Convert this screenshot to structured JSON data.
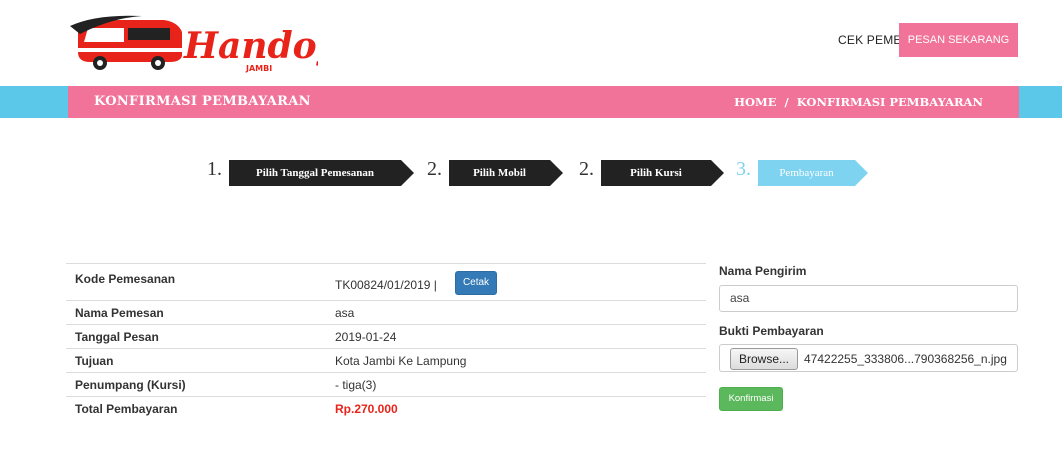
{
  "header": {
    "logo_text": "Handoyo",
    "logo_sub": "JAMBI",
    "nav_cek": "CEK PEMESANAN",
    "nav_pesan": "PESAN SEKARANG"
  },
  "band": {
    "title": "KONFIRMASI PEMBAYARAN",
    "breadcrumb_home": "HOME",
    "breadcrumb_sep": "/",
    "breadcrumb_current": "KONFIRMASI PEMBAYARAN"
  },
  "steps": [
    {
      "num": "1.",
      "label": "Pilih Tanggal Pemesanan"
    },
    {
      "num": "2.",
      "label": "Pilih Mobil"
    },
    {
      "num": "2.",
      "label": "Pilih Kursi"
    },
    {
      "num": "3.",
      "label": "Pembayaran"
    }
  ],
  "details": {
    "rows": [
      {
        "label": "Kode Pemesanan",
        "value": "TK00824/01/2019 |"
      },
      {
        "label": "Nama Pemesan",
        "value": "asa"
      },
      {
        "label": "Tanggal Pesan",
        "value": "2019-01-24"
      },
      {
        "label": "Tujuan",
        "value": "Kota Jambi Ke Lampung"
      },
      {
        "label": "Penumpang (Kursi)",
        "value": "- tiga(3)"
      },
      {
        "label": "Total Pembayaran",
        "value": "Rp.270.000"
      }
    ],
    "cetak_label": "Cetak"
  },
  "form": {
    "sender_label": "Nama Pengirim",
    "sender_value": "asa",
    "proof_label": "Bukti Pembayaran",
    "browse_label": "Browse...",
    "file_name": "47422255_333806...790368256_n.jpg",
    "submit_label": "Konfirmasi"
  },
  "colors": {
    "pink": "#f2739a",
    "sky": "#5bc8ea",
    "step_dark": "#222222",
    "step_active": "#7dd3f0",
    "total_red": "#e8241a"
  }
}
